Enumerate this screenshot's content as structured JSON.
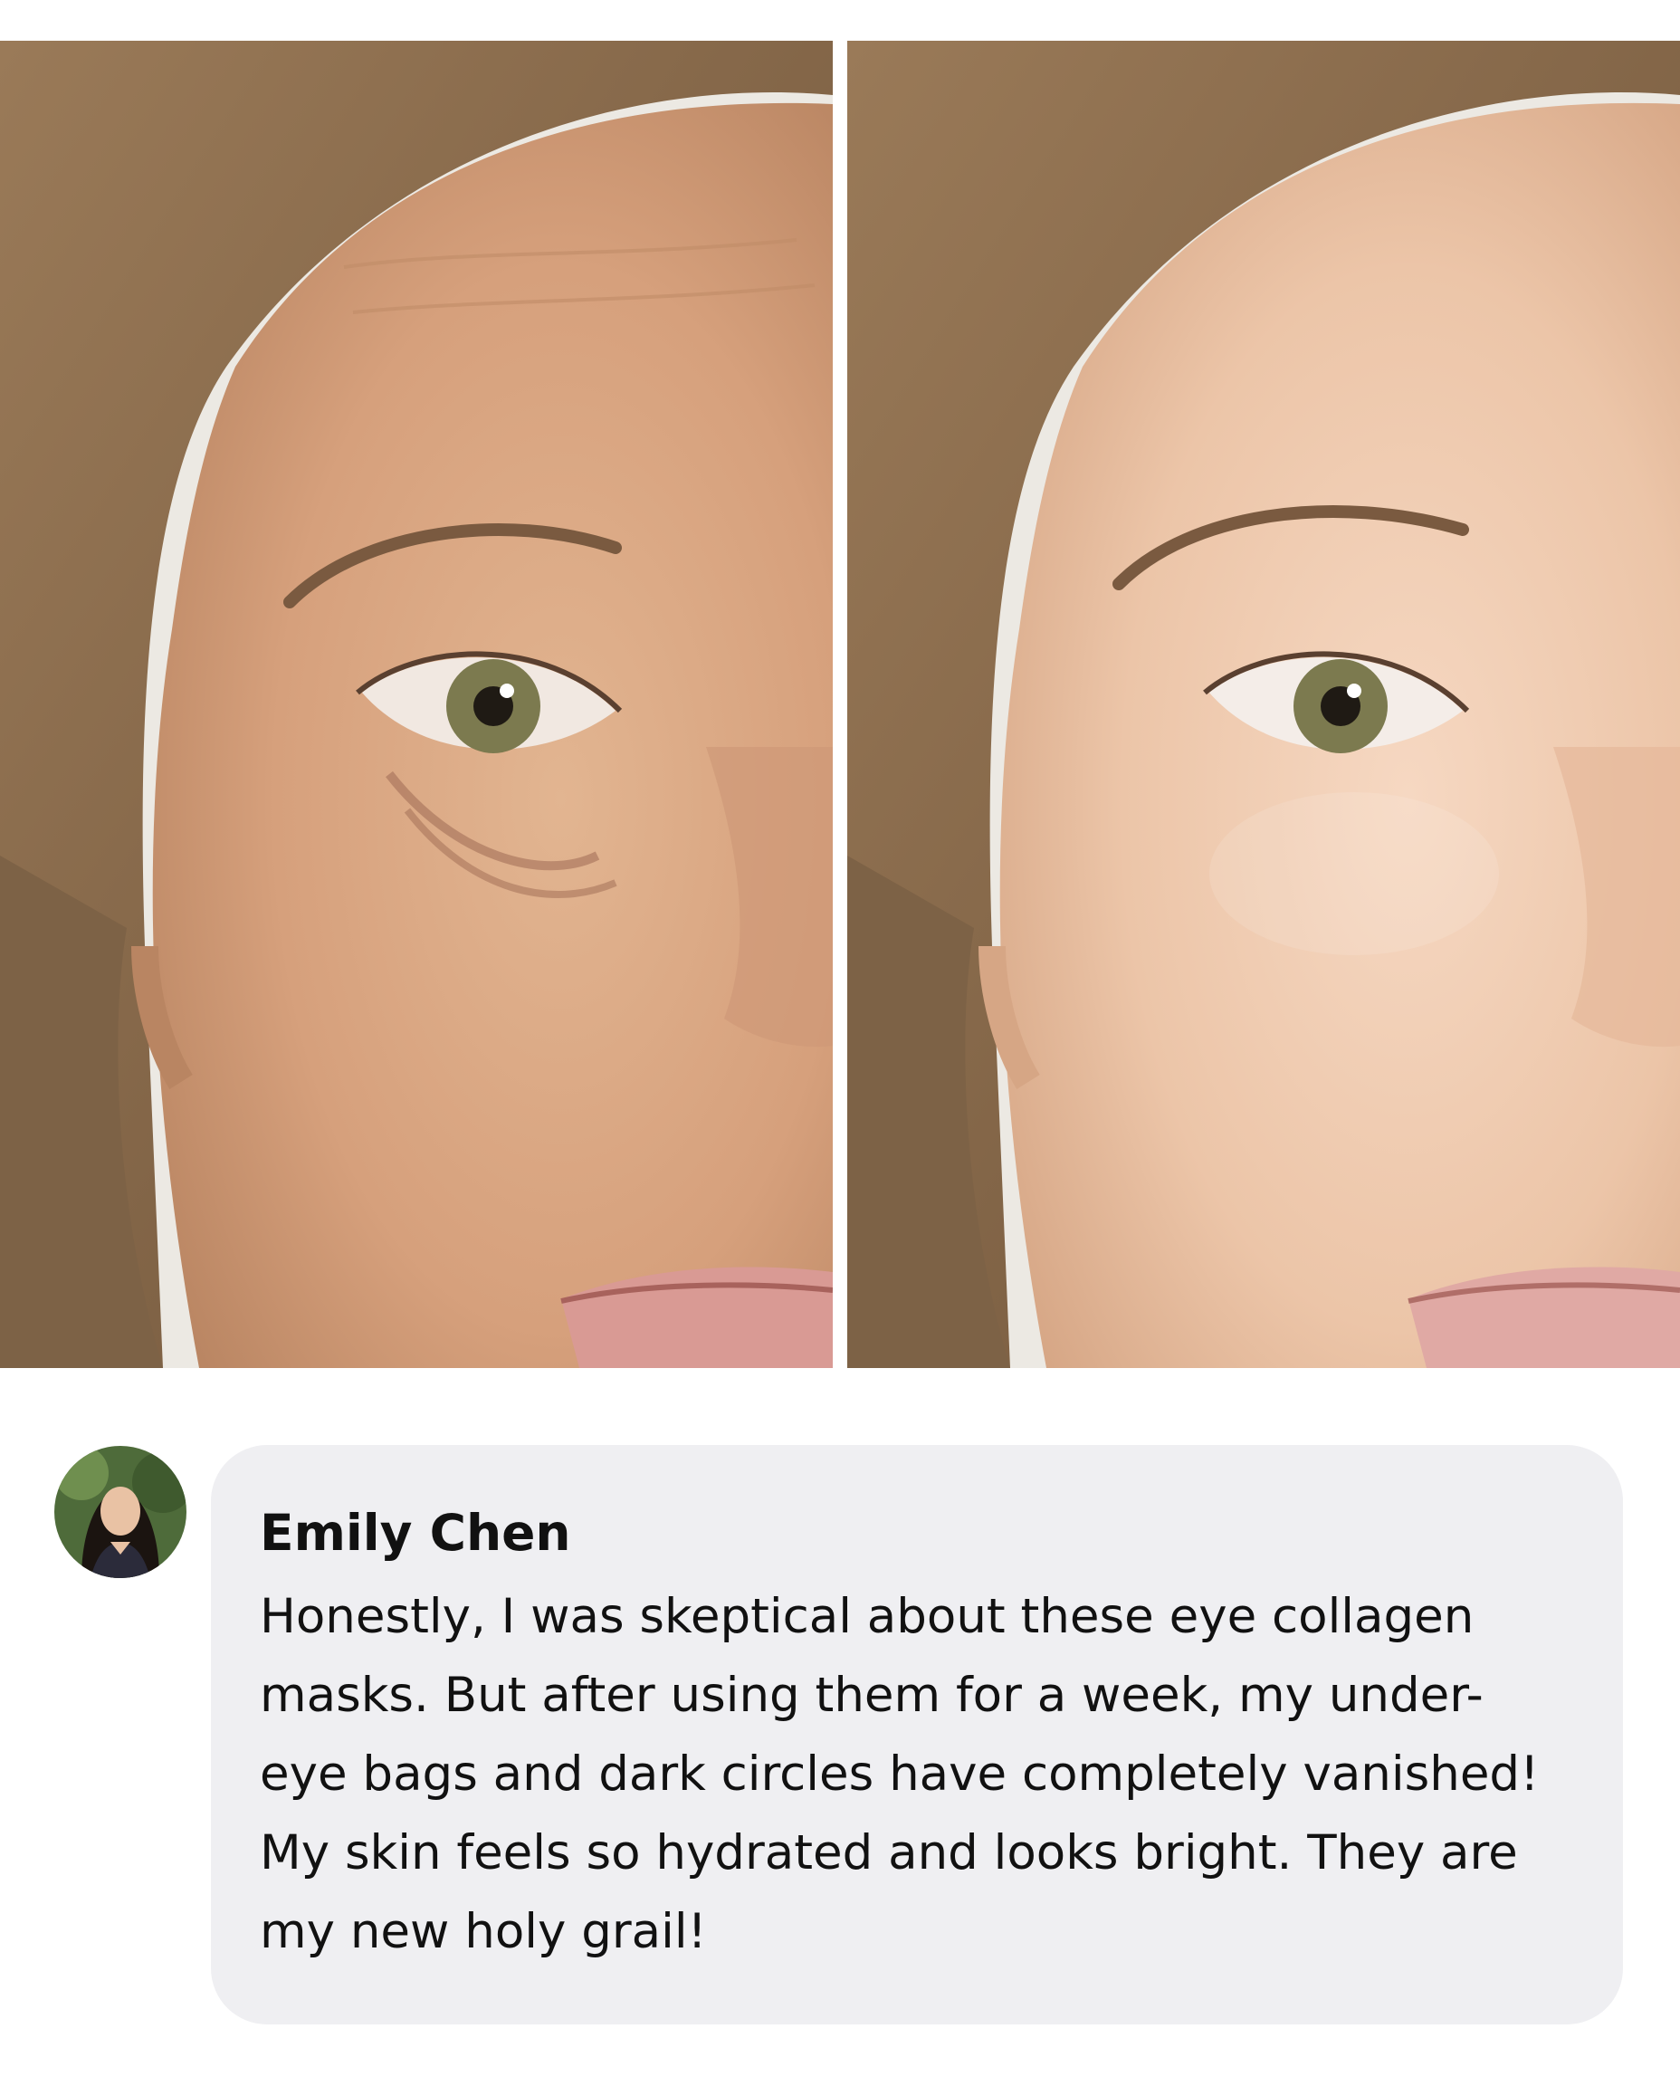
{
  "review": {
    "author": "Emily Chen",
    "text": "Honestly, I was skeptical about these eye collagen masks. But after using them for a week, my under-eye bags and dark circles have completely vanished! My skin feels so hydrated and looks bright. They are my new holy grail!"
  },
  "colors": {
    "page_background": "#ffffff",
    "bubble_background": "#efeff2",
    "text": "#111111",
    "skin_before": "#d9a882",
    "skin_after": "#efcbb2",
    "hair": "#8a6a4a"
  }
}
